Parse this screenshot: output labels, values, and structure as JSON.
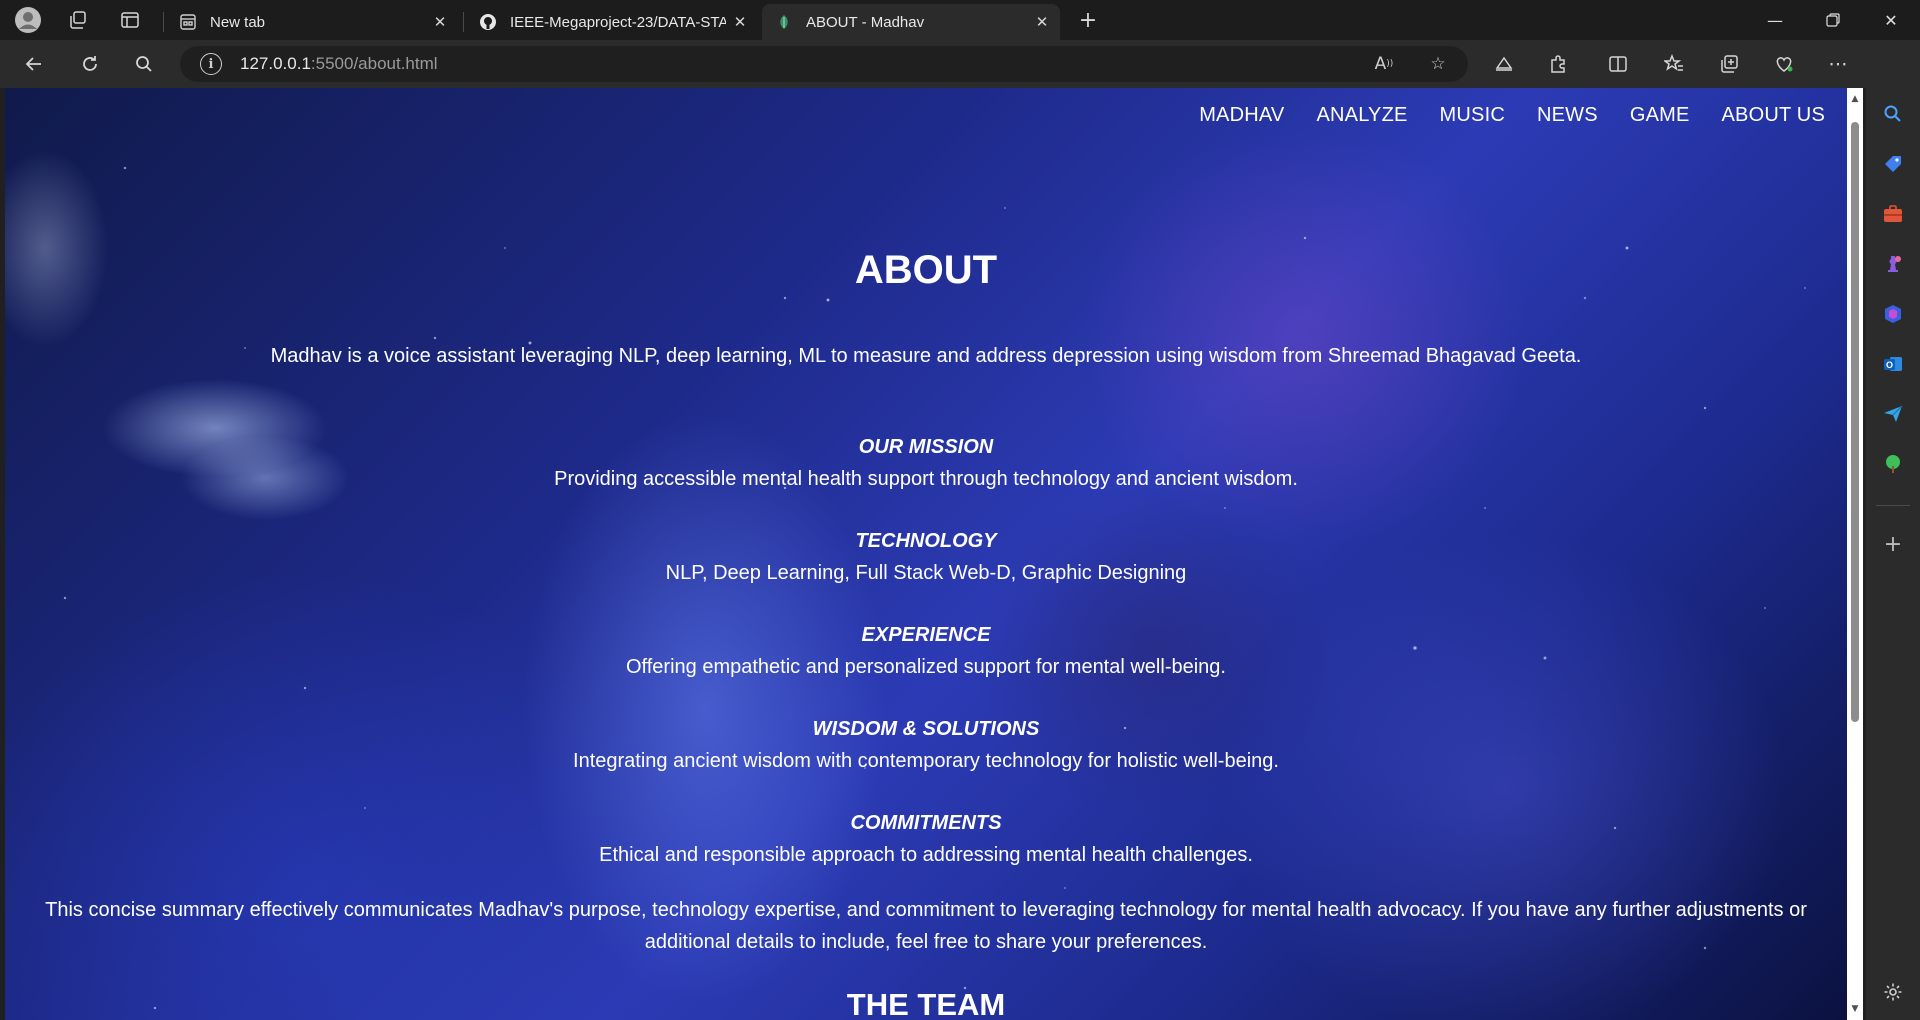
{
  "browser": {
    "tabs": [
      {
        "title": "New tab",
        "icon": "newtab-icon"
      },
      {
        "title": "IEEE-Megaproject-23/DATA-STAR",
        "icon": "github-icon"
      },
      {
        "title": "ABOUT - Madhav",
        "icon": "madhav-favicon"
      }
    ],
    "active_tab": 2,
    "url_host": "127.0.0.1",
    "url_path": ":5500/about.html"
  },
  "page": {
    "nav": [
      "MADHAV",
      "ANALYZE",
      "MUSIC",
      "NEWS",
      "GAME",
      "ABOUT US"
    ],
    "title": "ABOUT",
    "intro": "Madhav is a voice assistant leveraging NLP, deep learning, ML to measure and address depression using wisdom from Shreemad Bhagavad Geeta.",
    "sections": [
      {
        "heading": "OUR MISSION",
        "text": "Providing accessible mental health support through technology and ancient wisdom."
      },
      {
        "heading": "TECHNOLOGY",
        "text": "NLP, Deep Learning, Full Stack Web-D, Graphic Designing"
      },
      {
        "heading": "EXPERIENCE",
        "text": "Offering empathetic and personalized support for mental well-being."
      },
      {
        "heading": "WISDOM & SOLUTIONS",
        "text": "Integrating ancient wisdom with contemporary technology for holistic well-being."
      },
      {
        "heading": "COMMITMENTS",
        "text": "Ethical and responsible approach to addressing mental health challenges."
      }
    ],
    "summary": "This concise summary effectively communicates Madhav's purpose, technology expertise, and commitment to leveraging technology for mental health advocacy. If you have any further adjustments or additional details to include, feel free to share your preferences.",
    "team_heading": "THE TEAM"
  },
  "colors": {
    "nav_text": "#ffffff",
    "space_dark": "#0b1240",
    "space_mid": "#2c3bb5"
  }
}
